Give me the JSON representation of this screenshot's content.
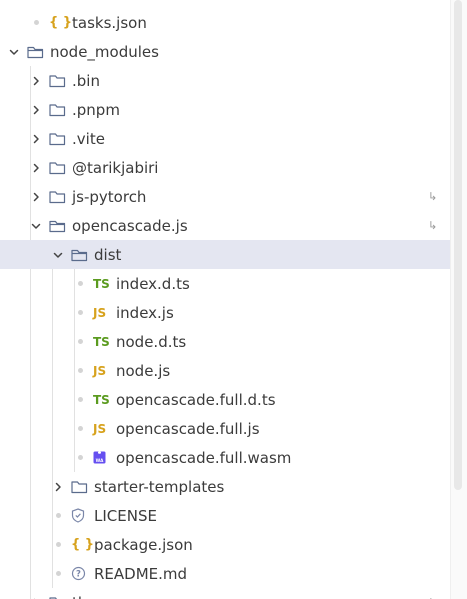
{
  "tree": {
    "items": [
      {
        "label": "tasks.json",
        "kind": "json-file",
        "depth": 1,
        "chevron": "none",
        "dot": true
      },
      {
        "label": "node_modules",
        "kind": "folder",
        "depth": 0,
        "chevron": "down"
      },
      {
        "label": ".bin",
        "kind": "folder",
        "depth": 1,
        "chevron": "right"
      },
      {
        "label": ".pnpm",
        "kind": "folder",
        "depth": 1,
        "chevron": "right"
      },
      {
        "label": ".vite",
        "kind": "folder",
        "depth": 1,
        "chevron": "right"
      },
      {
        "label": "@tarikjabiri",
        "kind": "folder",
        "depth": 1,
        "chevron": "right"
      },
      {
        "label": "js-pytorch",
        "kind": "folder",
        "depth": 1,
        "chevron": "right",
        "link": true
      },
      {
        "label": "opencascade.js",
        "kind": "folder",
        "depth": 1,
        "chevron": "down",
        "link": true
      },
      {
        "label": "dist",
        "kind": "folder",
        "depth": 2,
        "chevron": "down",
        "selected": true
      },
      {
        "label": "index.d.ts",
        "kind": "ts-file",
        "depth": 3,
        "chevron": "none",
        "dot": true
      },
      {
        "label": "index.js",
        "kind": "js-file",
        "depth": 3,
        "chevron": "none",
        "dot": true
      },
      {
        "label": "node.d.ts",
        "kind": "ts-file",
        "depth": 3,
        "chevron": "none",
        "dot": true
      },
      {
        "label": "node.js",
        "kind": "js-file",
        "depth": 3,
        "chevron": "none",
        "dot": true
      },
      {
        "label": "opencascade.full.d.ts",
        "kind": "ts-file",
        "depth": 3,
        "chevron": "none",
        "dot": true
      },
      {
        "label": "opencascade.full.js",
        "kind": "js-file",
        "depth": 3,
        "chevron": "none",
        "dot": true
      },
      {
        "label": "opencascade.full.wasm",
        "kind": "wasm-file",
        "depth": 3,
        "chevron": "none",
        "dot": true
      },
      {
        "label": "starter-templates",
        "kind": "folder",
        "depth": 2,
        "chevron": "right"
      },
      {
        "label": "LICENSE",
        "kind": "license-file",
        "depth": 2,
        "chevron": "none",
        "dot": true
      },
      {
        "label": "package.json",
        "kind": "json-file",
        "depth": 2,
        "chevron": "none",
        "dot": true
      },
      {
        "label": "README.md",
        "kind": "readme-file",
        "depth": 2,
        "chevron": "none",
        "dot": true
      },
      {
        "label": "three",
        "kind": "folder",
        "depth": 1,
        "chevron": "right",
        "link": true
      }
    ]
  },
  "badges": {
    "ts": "TS",
    "js": "JS",
    "json": "{ }",
    "link": "↳"
  },
  "colors": {
    "selected_bg": "#e4e6f1",
    "ts_badge": "#5b9b1f",
    "js_badge": "#d7a21d",
    "wasm_icon": "#654ff0",
    "folder_stroke": "#5a6b8c"
  }
}
